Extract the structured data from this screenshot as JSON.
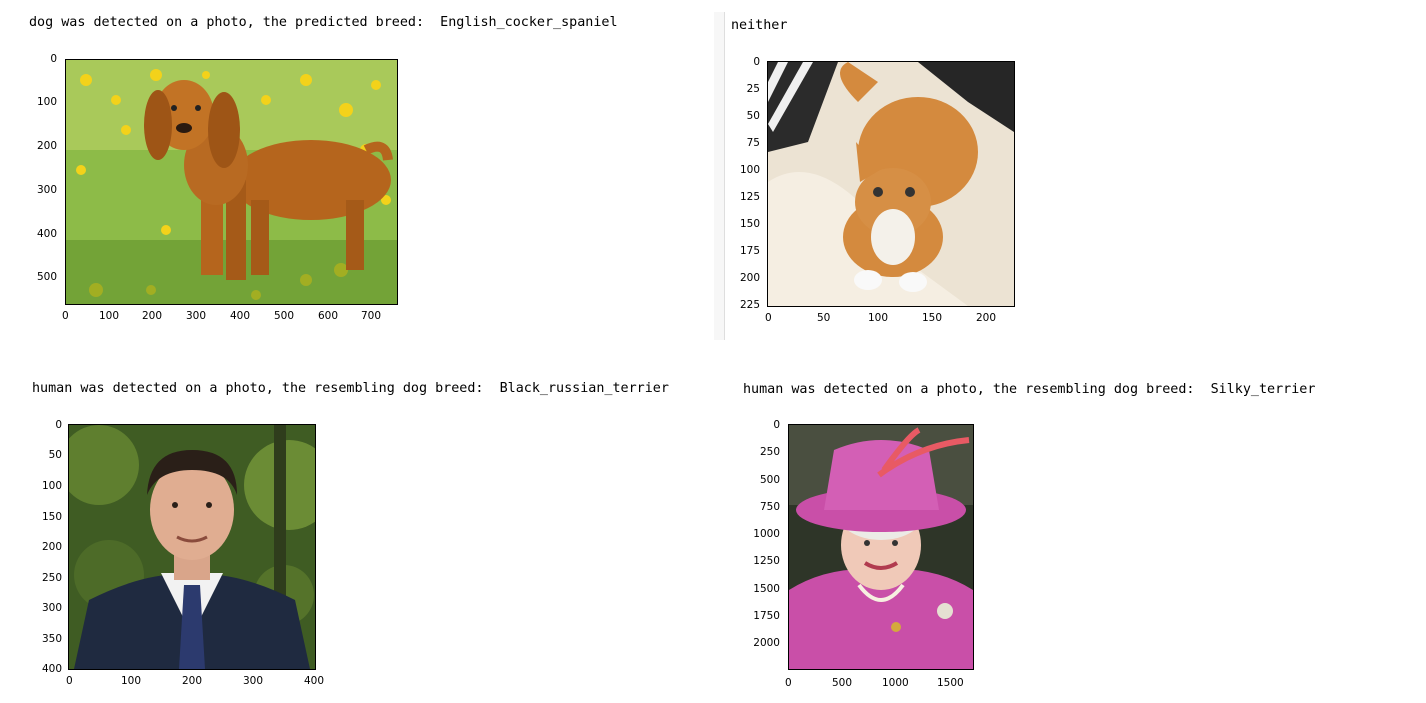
{
  "panels": [
    {
      "caption": "dog was detected on a photo, the predicted breed:  English_cocker_spaniel",
      "y_ticks": [
        "0",
        "100",
        "200",
        "300",
        "400",
        "500"
      ],
      "x_ticks": [
        "0",
        "100",
        "200",
        "300",
        "400",
        "500",
        "600",
        "700"
      ],
      "image_subject": "english-cocker-spaniel-in-meadow"
    },
    {
      "caption": "neither",
      "y_ticks": [
        "0",
        "25",
        "50",
        "75",
        "100",
        "125",
        "150",
        "175",
        "200",
        "225"
      ],
      "x_ticks": [
        "0",
        "50",
        "100",
        "150",
        "200"
      ],
      "image_subject": "orange-tabby-cat-on-pillow"
    },
    {
      "caption": "human was detected on a photo, the resembling dog breed:  Black_russian_terrier",
      "y_ticks": [
        "0",
        "50",
        "100",
        "150",
        "200",
        "250",
        "300",
        "350",
        "400"
      ],
      "x_ticks": [
        "0",
        "100",
        "200",
        "300",
        "400"
      ],
      "image_subject": "man-in-dark-suit-portrait"
    },
    {
      "caption": "human was detected on a photo, the resembling dog breed:  Silky_terrier",
      "y_ticks": [
        "0",
        "250",
        "500",
        "750",
        "1000",
        "1250",
        "1500",
        "1750",
        "2000"
      ],
      "x_ticks": [
        "0",
        "500",
        "1000",
        "1500"
      ],
      "image_subject": "woman-in-pink-hat-portrait"
    }
  ],
  "colors": {
    "grass": "#79a83a",
    "dog_coat": "#b5651d",
    "cat_coat": "#d48a3e",
    "pillow": "#ece3d3",
    "suit": "#1f2a40",
    "pink_outfit": "#c94fa8",
    "foliage": "#3f5c23"
  }
}
